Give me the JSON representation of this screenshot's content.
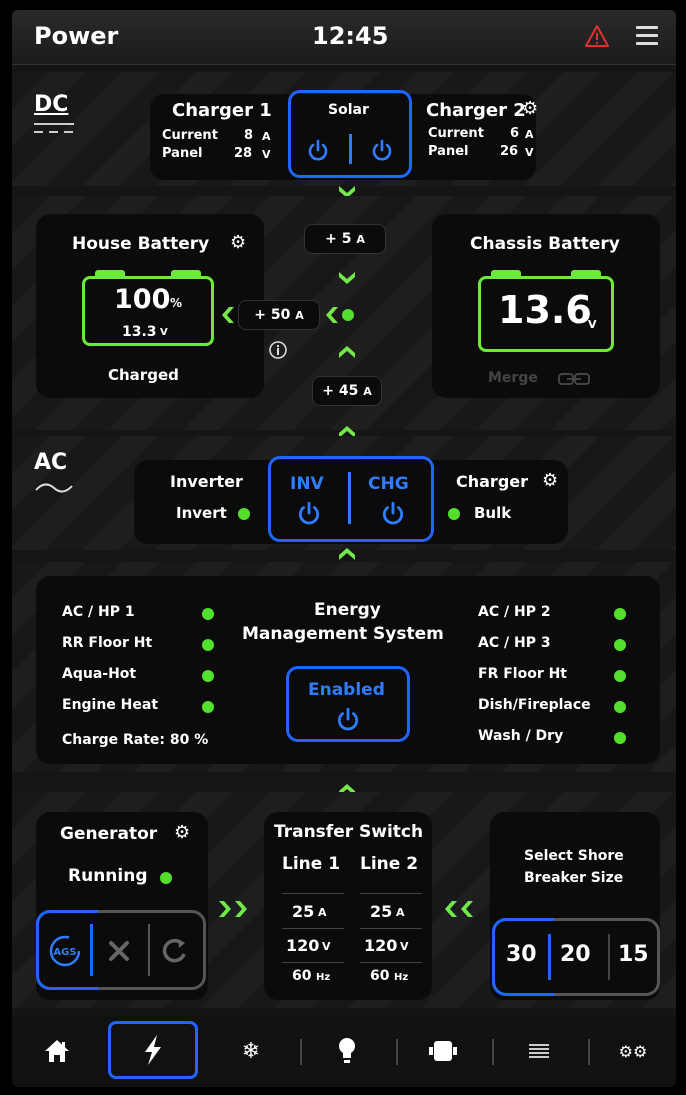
{
  "header": {
    "title": "Power",
    "clock": "12:45"
  },
  "dc": {
    "label": "DC",
    "charger1": {
      "title": "Charger 1",
      "current_label": "Current",
      "current_value": "8",
      "current_unit": "A",
      "panel_label": "Panel",
      "panel_value": "28",
      "panel_unit": "V"
    },
    "solar": {
      "title": "Solar"
    },
    "charger2": {
      "title": "Charger 2",
      "current_label": "Current",
      "current_value": "6",
      "current_unit": "A",
      "panel_label": "Panel",
      "panel_value": "26",
      "panel_unit": "V"
    }
  },
  "flows": {
    "top": {
      "value": "+ 5",
      "unit": "A"
    },
    "house": {
      "value": "+ 50",
      "unit": "A"
    },
    "bottom": {
      "value": "+ 45",
      "unit": "A"
    }
  },
  "house_battery": {
    "title": "House Battery",
    "percent": "100",
    "percent_unit": "%",
    "voltage": "13.3",
    "voltage_unit": "V",
    "status": "Charged"
  },
  "chassis_battery": {
    "title": "Chassis Battery",
    "voltage": "13.6",
    "voltage_unit": "V",
    "merge": "Merge"
  },
  "ac": {
    "label": "AC",
    "inverter": {
      "title": "Inverter",
      "status": "Invert"
    },
    "inv_button": "INV",
    "chg_button": "CHG",
    "charger": {
      "title": "Charger",
      "status": "Bulk"
    }
  },
  "ems": {
    "title_line1": "Energy",
    "title_line2": "Management System",
    "button": "Enabled",
    "left": [
      "AC / HP 1",
      "RR Floor Ht",
      "Aqua-Hot",
      "Engine Heat"
    ],
    "right": [
      "AC / HP 2",
      "AC / HP 3",
      "FR Floor Ht",
      "Dish/Fireplace",
      "Wash / Dry"
    ],
    "charge_rate": "Charge Rate: 80 %"
  },
  "generator": {
    "title": "Generator",
    "status": "Running",
    "ags": "AGS"
  },
  "transfer": {
    "title": "Transfer Switch",
    "line1": {
      "label": "Line 1",
      "amps": "25",
      "volts": "120",
      "hz": "60"
    },
    "line2": {
      "label": "Line 2",
      "amps": "25",
      "volts": "120",
      "hz": "60"
    },
    "units": {
      "amps": "A",
      "volts": "V",
      "hz": "Hz"
    }
  },
  "shore": {
    "title_line1": "Select Shore",
    "title_line2": "Breaker Size",
    "options": [
      "30",
      "20",
      "15"
    ],
    "selected": "30"
  },
  "colors": {
    "accent_blue": "#1e66ff",
    "status_green": "#52e02c",
    "warning_red": "#e03030"
  },
  "nav": {
    "items": [
      "home-icon",
      "power-icon",
      "snowflake-icon",
      "bulb-icon",
      "slideout-icon",
      "list-icon",
      "gears-icon"
    ],
    "active": "power-icon"
  }
}
